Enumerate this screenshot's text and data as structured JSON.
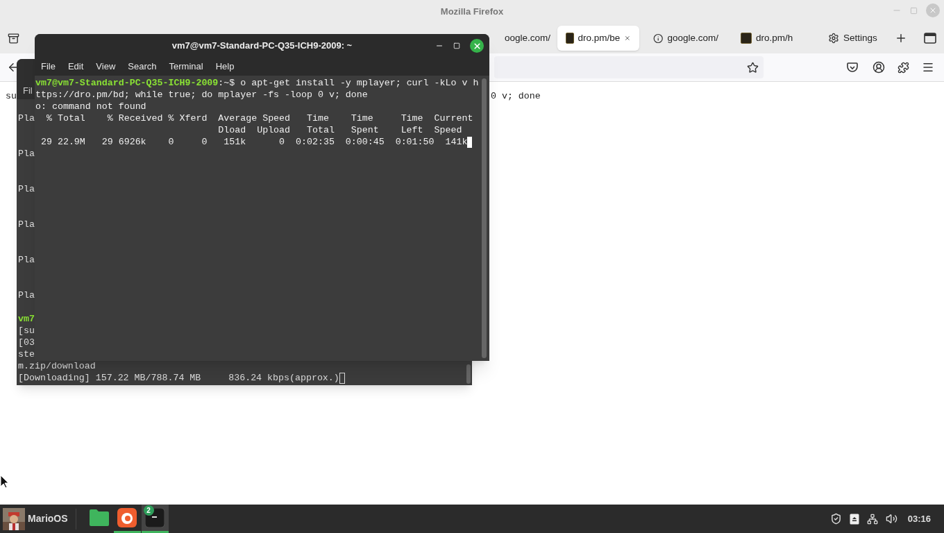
{
  "browser": {
    "title": "Mozilla Firefox",
    "tabs": [
      {
        "label": "oogle.com/",
        "selected": false,
        "kind": "partial"
      },
      {
        "label": "dro.pm/be",
        "selected": true,
        "kind": "site"
      },
      {
        "label": "google.com/",
        "selected": false,
        "kind": "info"
      },
      {
        "label": "dro.pm/h",
        "selected": false,
        "kind": "site"
      },
      {
        "label": "Settings",
        "selected": false,
        "kind": "settings"
      }
    ],
    "page_text": [
      "su",
      "0 v; done"
    ]
  },
  "back_terminal": {
    "menu": [
      "Fil"
    ],
    "lines": [
      {
        "kind": "block",
        "text": "Pla"
      },
      {
        "kind": "block",
        "text": "Pla"
      },
      {
        "kind": "block",
        "text": "Pla"
      },
      {
        "kind": "block",
        "text": "Pla"
      },
      {
        "kind": "block",
        "text": "Pla"
      },
      {
        "kind": "block",
        "text": "Pla"
      },
      {
        "kind": "prompt",
        "text": "vm7"
      },
      {
        "kind": "output",
        "text": "[su"
      },
      {
        "kind": "output",
        "text": "[03"
      },
      {
        "kind": "output",
        "text": "ste"
      },
      {
        "kind": "output",
        "text": "m.zip/download"
      },
      {
        "kind": "cursor",
        "text": "[Downloading] 157.22 MB/788.74 MB     836.24 kbps(approx.)"
      }
    ]
  },
  "terminal": {
    "title": "vm7@vm7-Standard-PC-Q35-ICH9-2009: ~",
    "menu": [
      "File",
      "Edit",
      "View",
      "Search",
      "Terminal",
      "Help"
    ],
    "lines": [
      {
        "kind": "prompt",
        "prompt": "vm7@vm7-Standard-PC-Q35-ICH9-2009",
        "text": ":~$ o apt-get install -y mplayer; curl -kLo v h"
      },
      {
        "kind": "output",
        "text": "ttps://dro.pm/bd; while true; do mplayer -fs -loop 0 v; done"
      },
      {
        "kind": "output",
        "text": "o: command not found"
      },
      {
        "kind": "output",
        "text": "  % Total    % Received % Xferd  Average Speed   Time    Time     Time  Current"
      },
      {
        "kind": "output",
        "text": "                                 Dload  Upload   Total   Spent    Left  Speed"
      },
      {
        "kind": "cursor",
        "text": " 29 22.9M   29 6926k    0     0   151k      0  0:02:35  0:00:45  0:01:50  141k"
      }
    ]
  },
  "taskbar": {
    "menu_label": "MarioOS",
    "apps": [
      {
        "kind": "folder",
        "running": false,
        "active": false
      },
      {
        "kind": "browser",
        "running": true,
        "active": false
      },
      {
        "kind": "terminal",
        "running": true,
        "active": true,
        "badge": "2"
      }
    ],
    "clock": "03:16"
  }
}
